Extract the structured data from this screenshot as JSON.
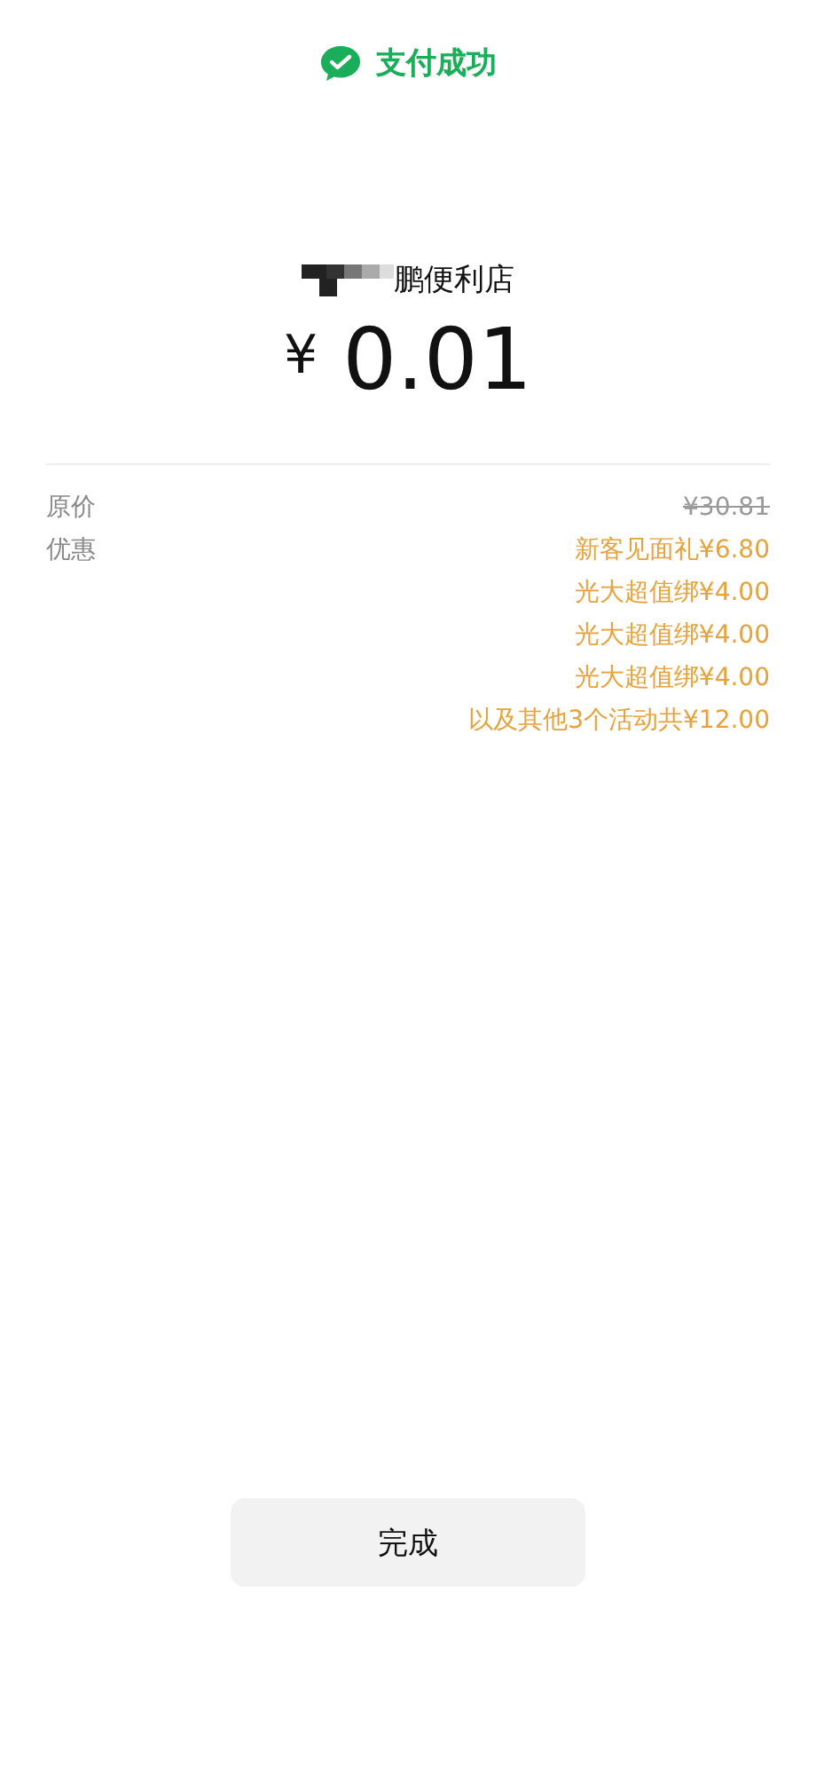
{
  "header": {
    "title": "支付成功"
  },
  "merchant": {
    "name": "鹏便利店",
    "redacted": true
  },
  "amount": {
    "currency": "¥",
    "value": "0.01"
  },
  "details": [
    {
      "label": "原价",
      "values": [
        {
          "text": "¥30.81",
          "struck": true,
          "kind": "price"
        }
      ]
    },
    {
      "label": "优惠",
      "values": [
        {
          "text": "新客见面礼¥6.80",
          "struck": false,
          "kind": "discount"
        },
        {
          "text": "光大超值绑¥4.00",
          "struck": false,
          "kind": "discount"
        },
        {
          "text": "光大超值绑¥4.00",
          "struck": false,
          "kind": "discount"
        },
        {
          "text": "光大超值绑¥4.00",
          "struck": false,
          "kind": "discount"
        },
        {
          "text": "以及其他3个活动共¥12.00",
          "struck": false,
          "kind": "discount"
        }
      ]
    }
  ],
  "done_button": {
    "label": "完成"
  }
}
